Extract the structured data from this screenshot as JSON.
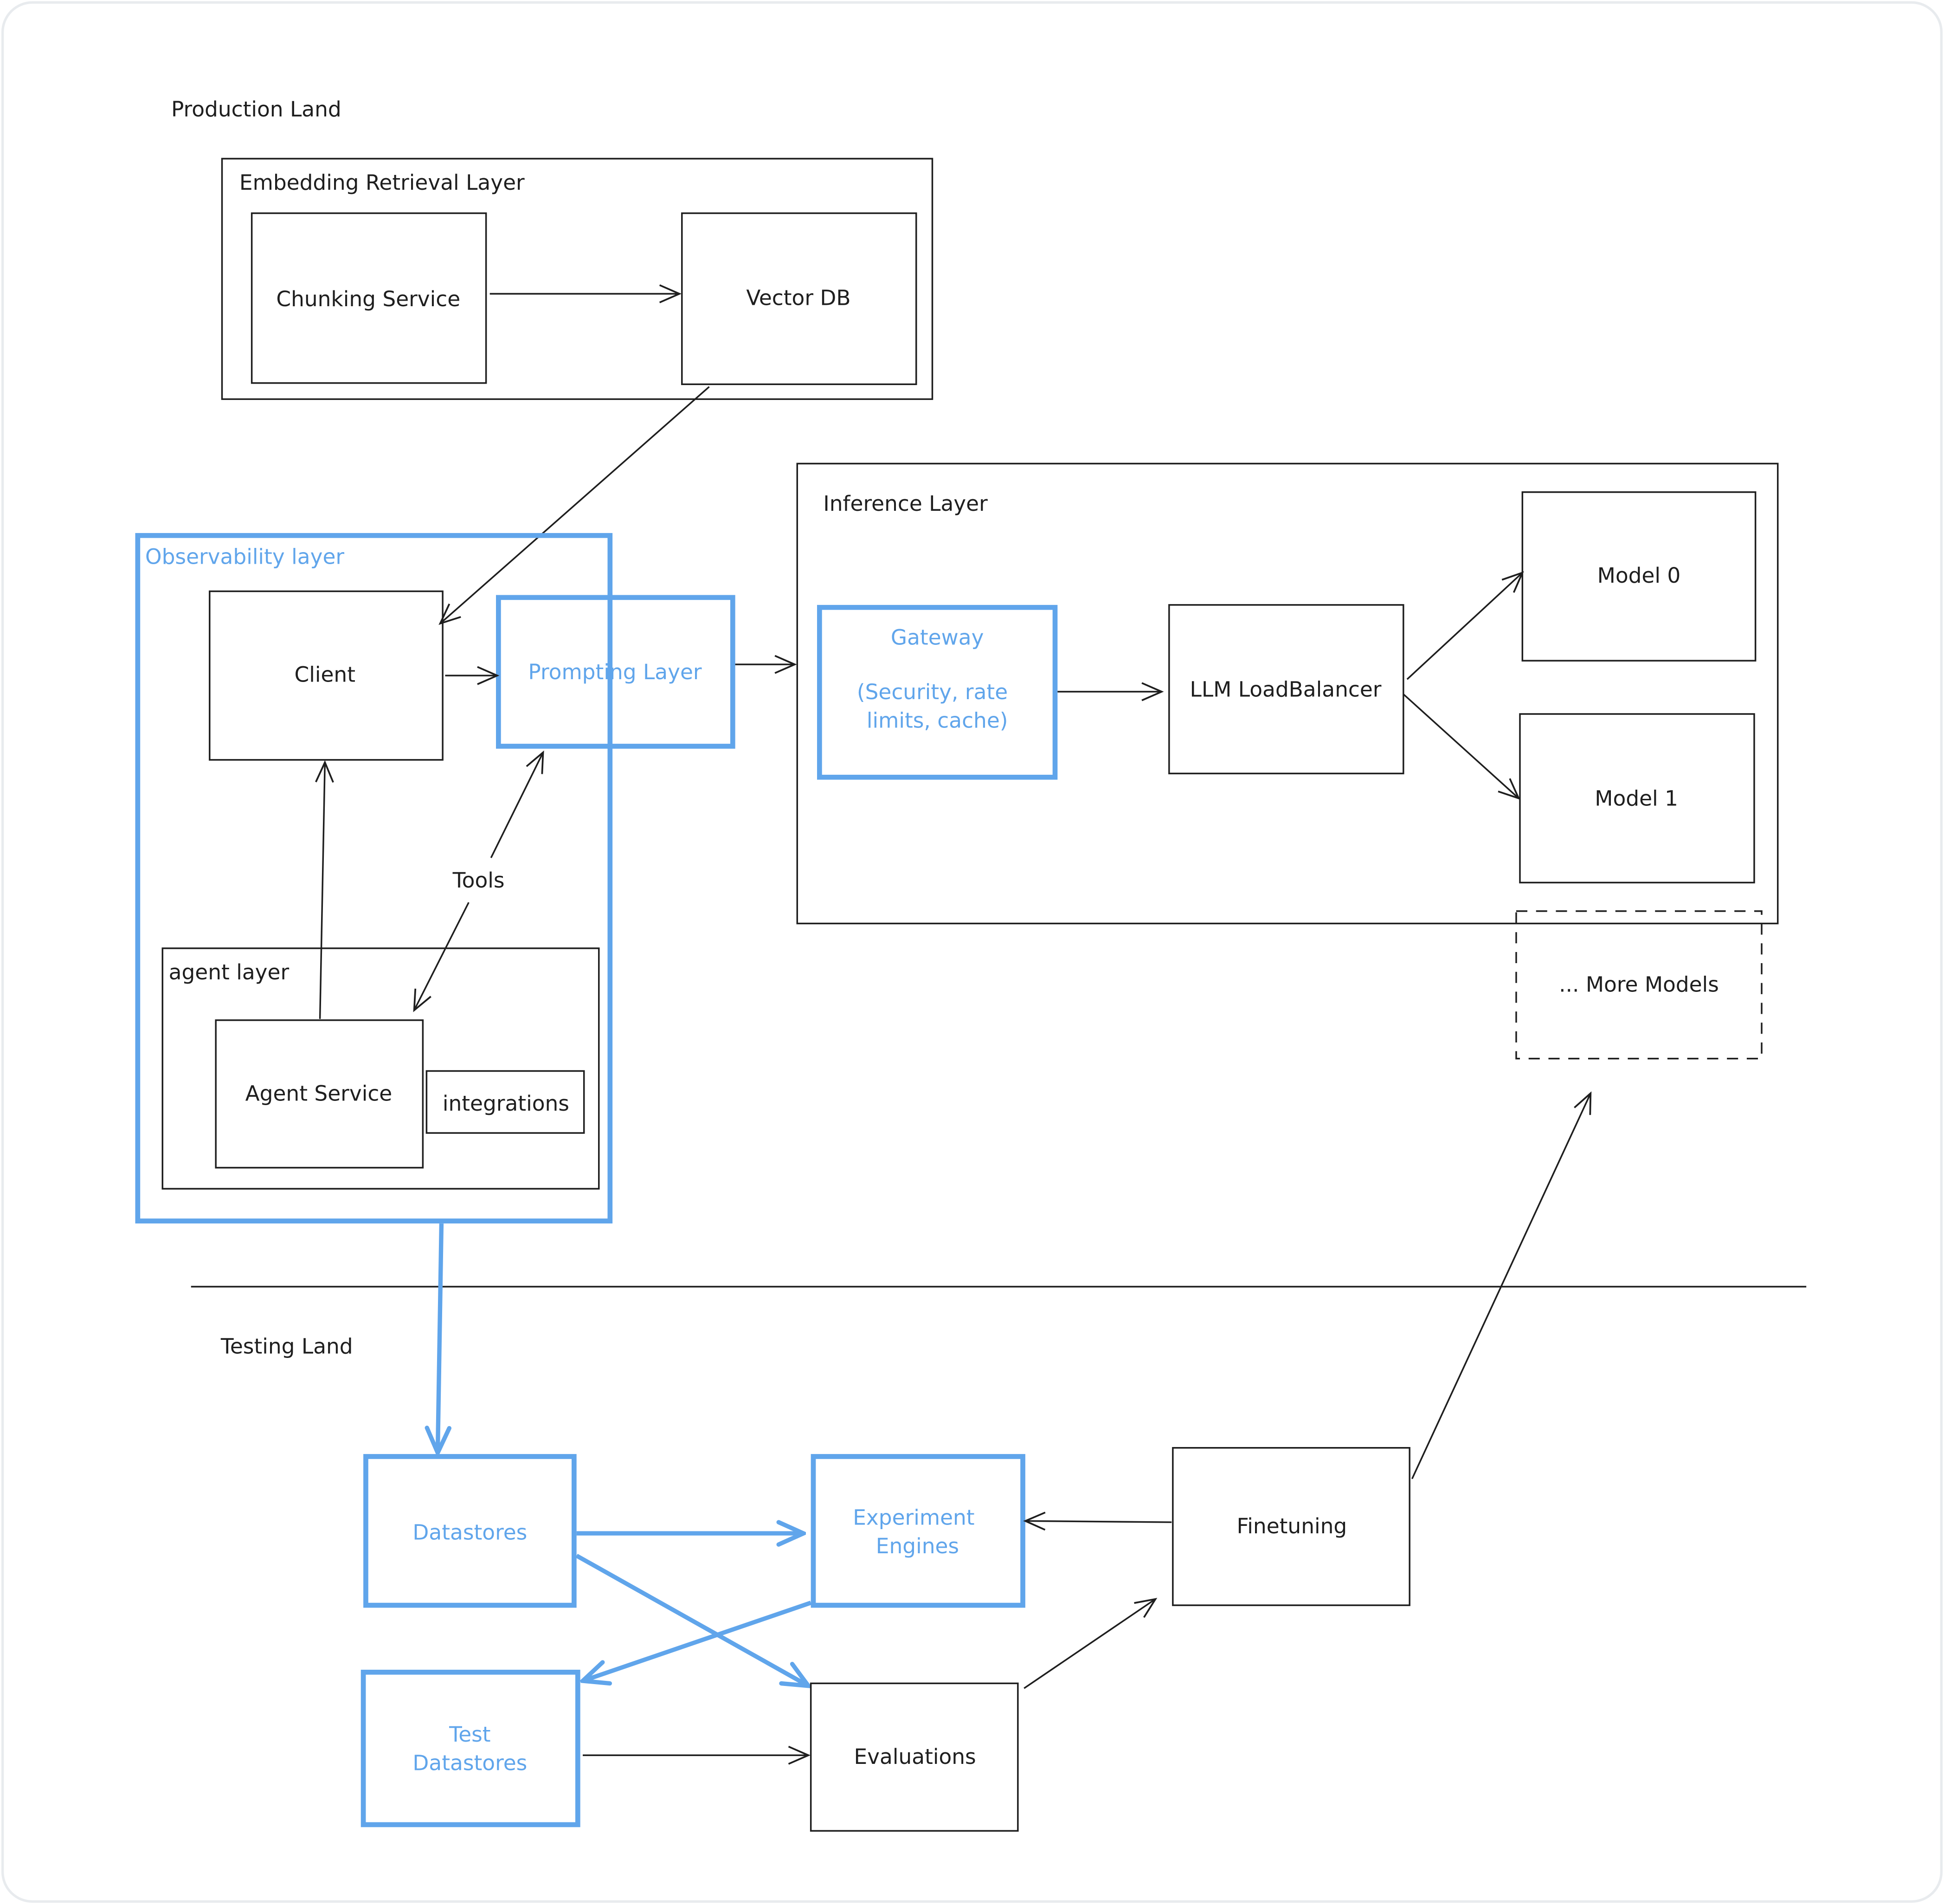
{
  "colors": {
    "accent": "#60a5eb",
    "ink": "#1e1e1e",
    "frame": "#e5e7eb"
  },
  "production": {
    "title": "Production Land",
    "embedding": {
      "label": "Embedding Retrieval Layer",
      "chunking": "Chunking Service",
      "vector_db": "Vector DB"
    },
    "observability": {
      "label": "Observability layer",
      "client": "Client",
      "prompting": "Prompting Layer",
      "tools": "Tools",
      "agent_layer": {
        "label": "agent layer",
        "agent_service": "Agent Service",
        "integrations": "integrations"
      }
    },
    "inference": {
      "label": "Inference Layer",
      "gateway_title": "Gateway",
      "gateway_line1": "(Security, rate",
      "gateway_line2": "limits, cache)",
      "load_balancer": "LLM LoadBalancer",
      "model0": "Model 0",
      "model1": "Model 1",
      "more_models": "... More Models"
    }
  },
  "testing": {
    "title": "Testing Land",
    "datastores": "Datastores",
    "experiment_line1": "Experiment",
    "experiment_line2": "Engines",
    "finetuning": "Finetuning",
    "test_ds_line1": "Test",
    "test_ds_line2": "Datastores",
    "evaluations": "Evaluations"
  }
}
